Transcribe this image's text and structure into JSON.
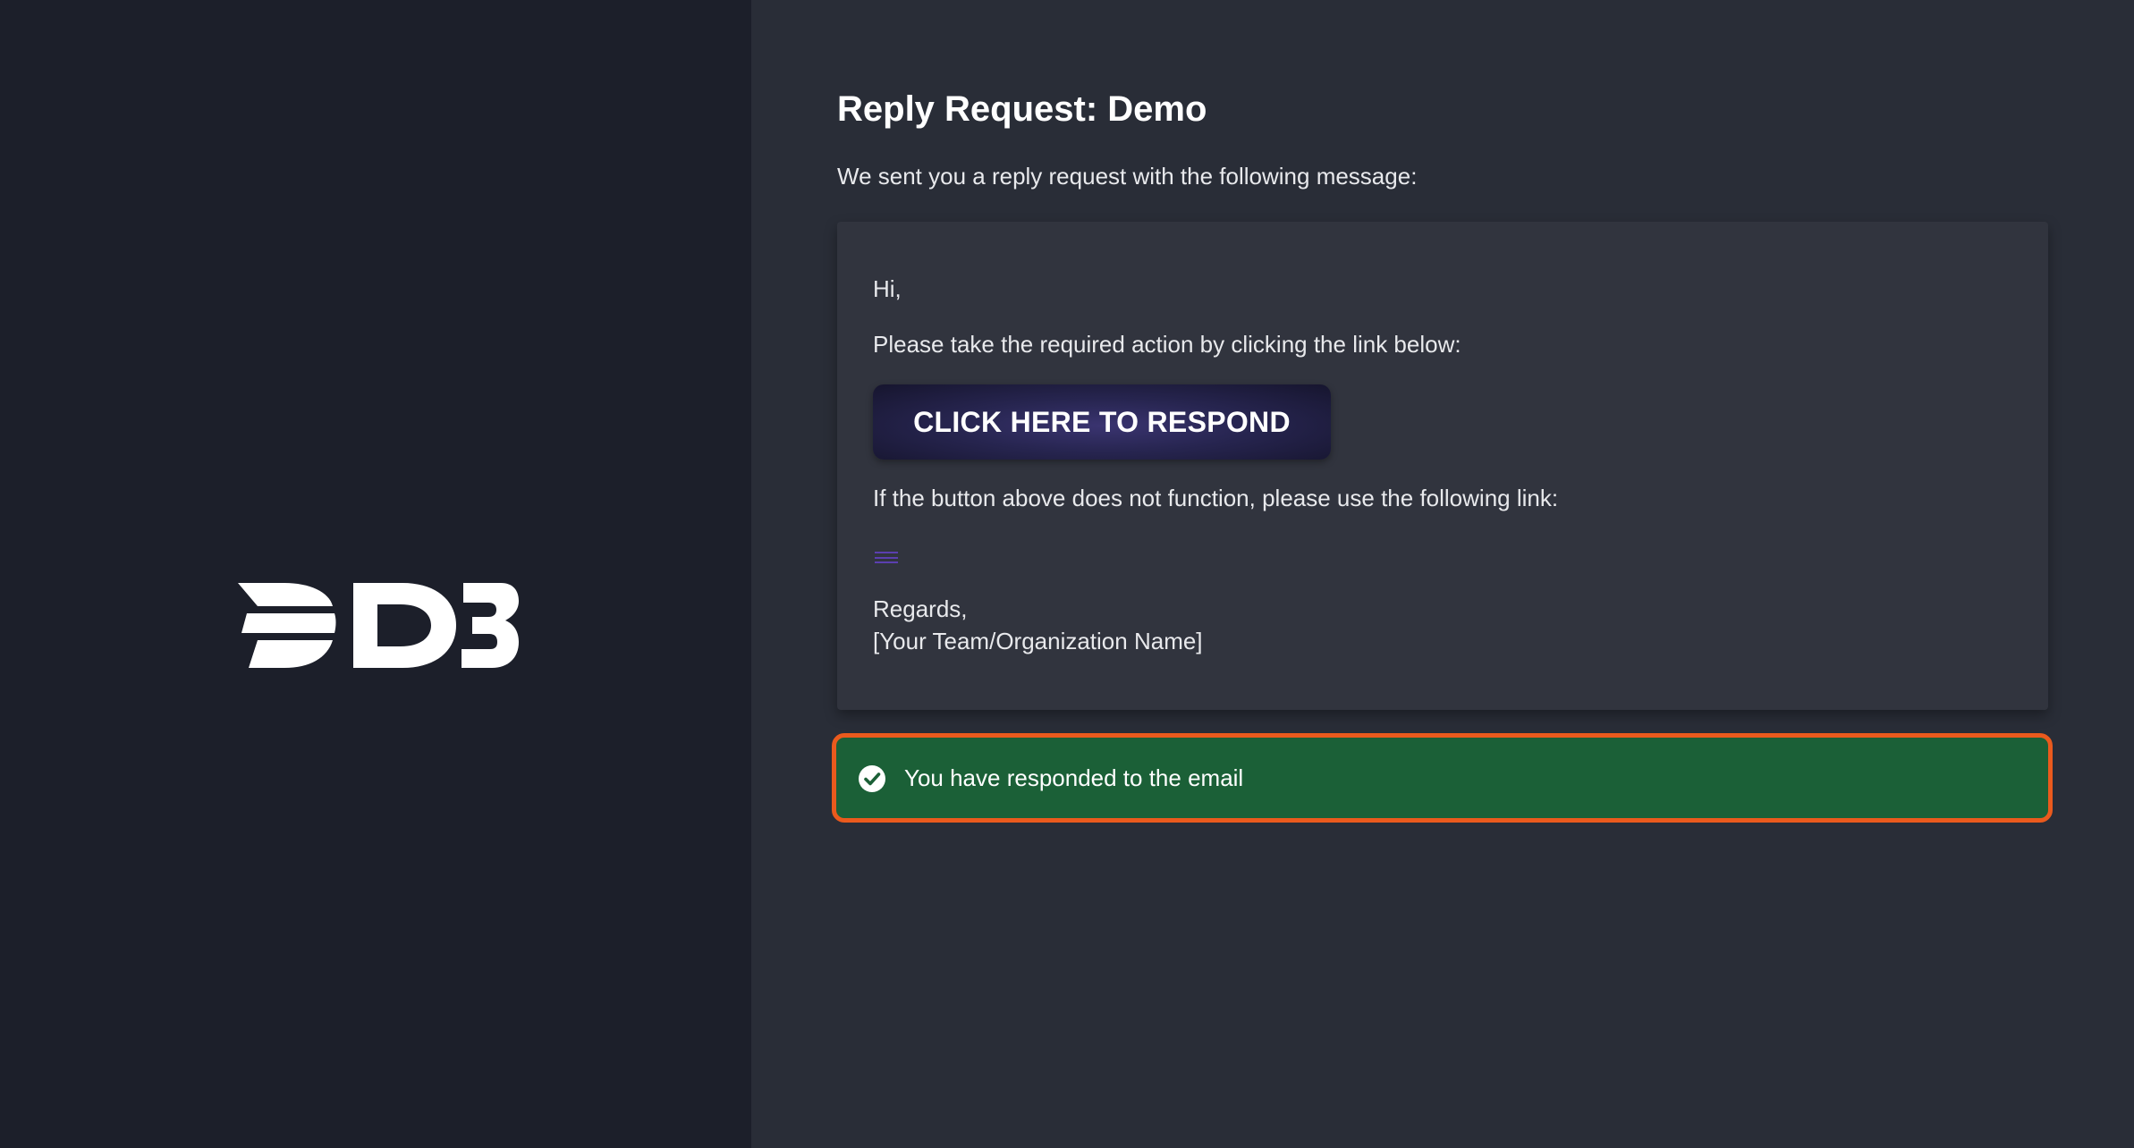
{
  "brand": {
    "logo_icon": "d3-logo",
    "logo_text": "D3"
  },
  "page": {
    "title": "Reply Request: Demo",
    "intro": "We sent you a reply request with the following message:"
  },
  "message": {
    "greeting": "Hi,",
    "instruction": "Please take the required action by clicking the link below:",
    "button_label": "CLICK HERE TO RESPOND",
    "fallback_text": "If the button above does not function, please use the following link:",
    "link_icon": "link-placeholder-icon",
    "closing": "Regards,",
    "signature": "[Your Team/Organization Name]"
  },
  "status": {
    "icon": "check-circle-icon",
    "text": "You have responded to the email"
  },
  "colors": {
    "left_panel": "#1c1f2a",
    "right_panel": "#292d37",
    "card": "#31343e",
    "success": "#1b6037",
    "highlight": "#ea5a1d",
    "button": "#272550"
  }
}
